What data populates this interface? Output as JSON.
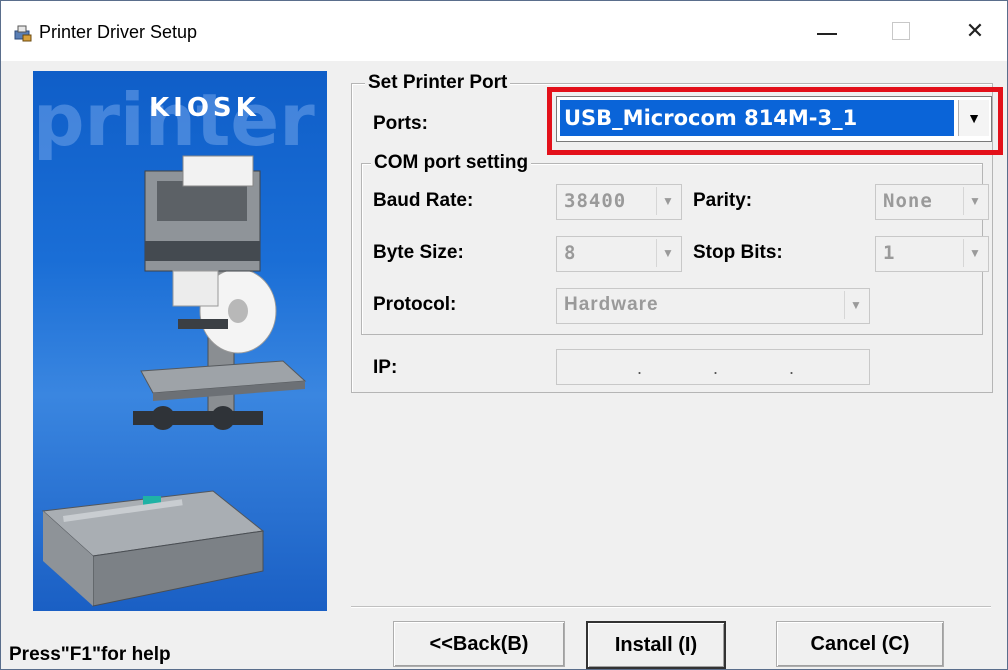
{
  "window": {
    "title": "Printer Driver Setup",
    "minimize_glyph": "—",
    "close_glyph": "✕"
  },
  "side_image": {
    "brand": "KIOSK",
    "watermark": "printer"
  },
  "set_printer_port": {
    "group_label": "Set Printer Port",
    "ports_label": "Ports:",
    "ports_value": "USB_Microcom 814M-3_1",
    "highlight_color": "#e3101a"
  },
  "com_port": {
    "group_label": "COM port setting",
    "baud_label": "Baud Rate:",
    "baud_value": "38400",
    "parity_label": "Parity:",
    "parity_value": "None",
    "byte_label": "Byte Size:",
    "byte_value": "8",
    "stop_label": "Stop Bits:",
    "stop_value": "1",
    "protocol_label": "Protocol:",
    "protocol_value": "Hardware"
  },
  "ip": {
    "label": "IP:",
    "dots": [
      ".",
      ".",
      "."
    ]
  },
  "buttons": {
    "back": "<<Back(B)",
    "install": "Install (I)",
    "cancel": "Cancel (C)"
  },
  "status": {
    "help": "Press\"F1\"for help"
  }
}
